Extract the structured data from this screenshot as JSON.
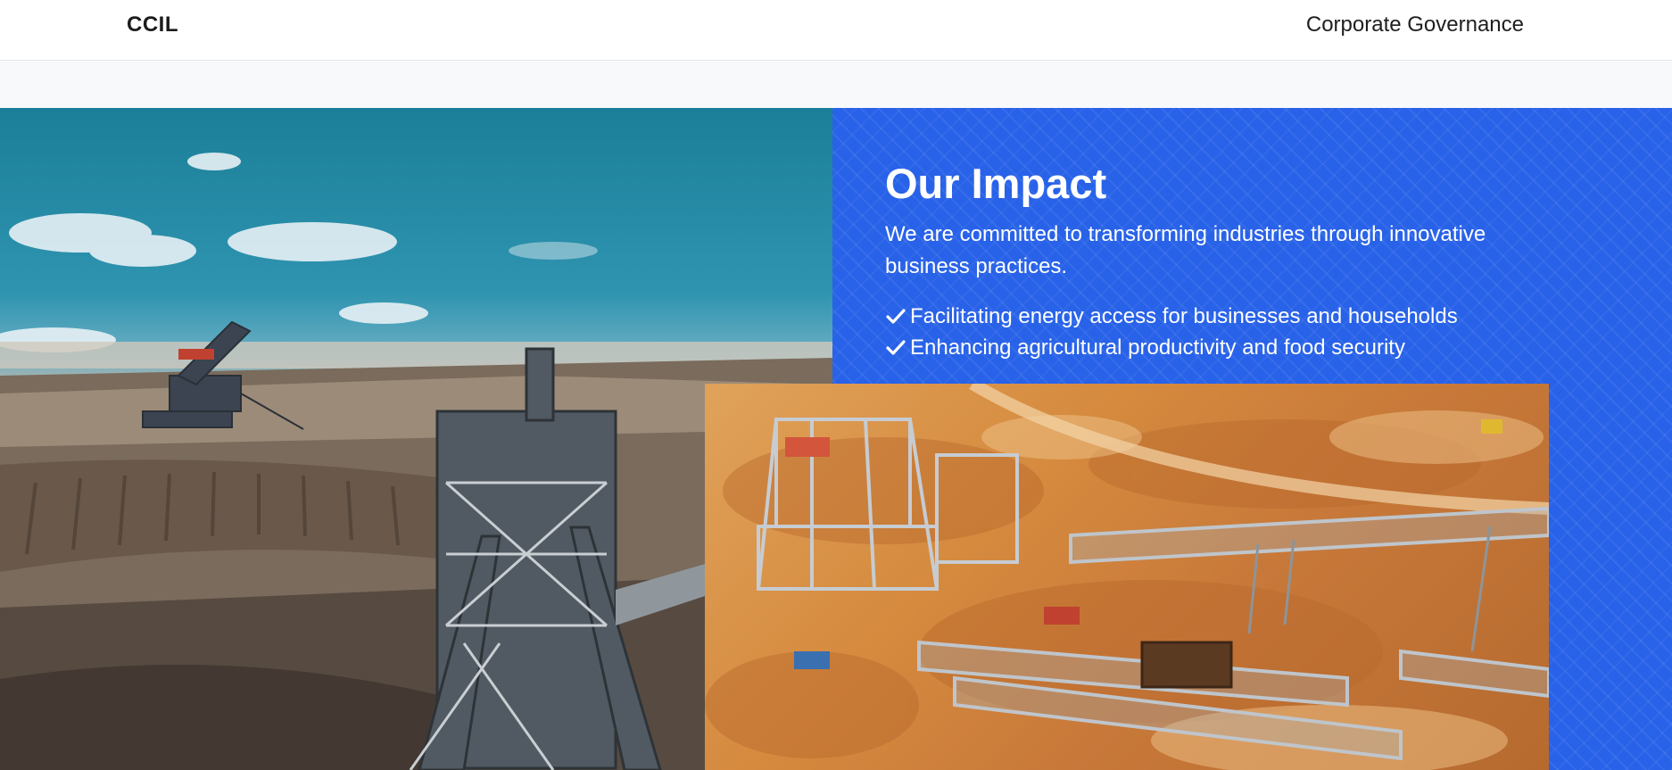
{
  "navbar": {
    "brand": "CCIL",
    "link": "Corporate Governance"
  },
  "impact": {
    "title": "Our Impact",
    "description": "We are committed to transforming industries through innovative business practices.",
    "items": [
      "Facilitating energy access for businesses and households",
      "Enhancing agricultural productivity and food security"
    ]
  },
  "icons": {
    "check": "check-icon"
  },
  "colors": {
    "panel_blue": "#2862e8",
    "text_white": "#ffffff",
    "nav_bg": "#ffffff"
  }
}
